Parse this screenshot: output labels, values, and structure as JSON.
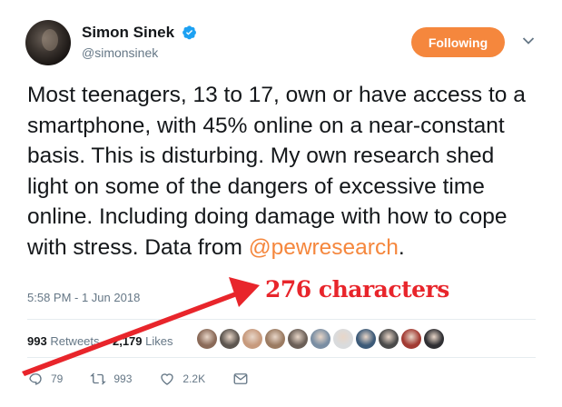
{
  "author": {
    "name": "Simon Sinek",
    "handle": "@simonsinek",
    "verified": true
  },
  "follow_button": {
    "label": "Following",
    "color": "#f5873d"
  },
  "tweet": {
    "text_before": "Most teenagers, 13 to 17, own or have access to a smartphone, with 45% online on a near-constant basis. This is disturbing. My own research shed light on some of the dangers of excessive time online. Including doing damage with how to cope with stress. Data from ",
    "mention": "@pewresearch",
    "text_after": ".",
    "timestamp": "5:58 PM - 1 Jun 2018"
  },
  "annotation": {
    "label": "276 characters",
    "color": "#e8252b"
  },
  "stats": {
    "retweets_count": "993",
    "retweets_label": "Retweets",
    "likes_count": "2,179",
    "likes_label": "Likes"
  },
  "likers": [
    {
      "color": "#8a6a58"
    },
    {
      "color": "#5d5650"
    },
    {
      "color": "#c79a7d"
    },
    {
      "color": "#9b7b62"
    },
    {
      "color": "#6b5f57"
    },
    {
      "color": "#7a8ea3"
    },
    {
      "color": "#d9dbdd"
    },
    {
      "color": "#3c5a78"
    },
    {
      "color": "#4a4a4a"
    },
    {
      "color": "#a23b33"
    },
    {
      "color": "#2f2f33"
    }
  ],
  "actions": {
    "reply_count": "79",
    "retweet_count": "993",
    "like_count": "2.2K"
  }
}
